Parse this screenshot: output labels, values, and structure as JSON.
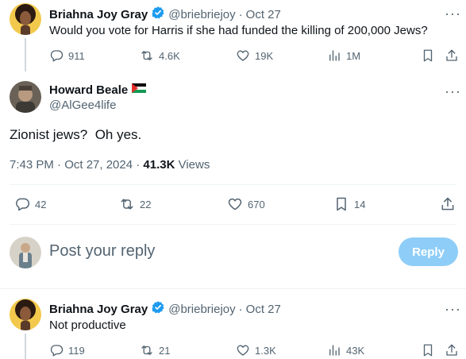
{
  "tweet1": {
    "name": "Briahna Joy Gray",
    "handle": "@briebriejoy",
    "separator": "·",
    "date": "Oct 27",
    "text": "Would you vote for Harris if she had funded the killing of 200,000 Jews?",
    "replies": "911",
    "reposts": "4.6K",
    "likes": "19K",
    "views": "1M"
  },
  "main_tweet": {
    "name": "Howard Beale",
    "handle": "@AlGee4life",
    "text": "Zionist jews?  Oh yes.",
    "time": "7:43 PM · Oct 27, 2024 · ",
    "views_count": "41.3K",
    "views_label": " Views",
    "replies": "42",
    "reposts": "22",
    "likes": "670",
    "bookmarks": "14"
  },
  "composer": {
    "placeholder": "Post your reply",
    "reply_label": "Reply"
  },
  "tweet3": {
    "name": "Briahna Joy Gray",
    "handle": "@briebriejoy",
    "separator": "·",
    "date": "Oct 27",
    "text": "Not productive",
    "replies": "119",
    "reposts": "21",
    "likes": "1.3K",
    "views": "43K"
  },
  "colors": {
    "accent": "#1d9bf0",
    "reply_button_disabled": "#8ecdf8",
    "secondary_text": "#536471",
    "border": "#eff3f4"
  },
  "icons": [
    "reply-icon",
    "repost-icon",
    "like-icon",
    "views-icon",
    "bookmark-icon",
    "share-icon",
    "more-icon",
    "verified-icon",
    "palestine-flag-icon"
  ]
}
